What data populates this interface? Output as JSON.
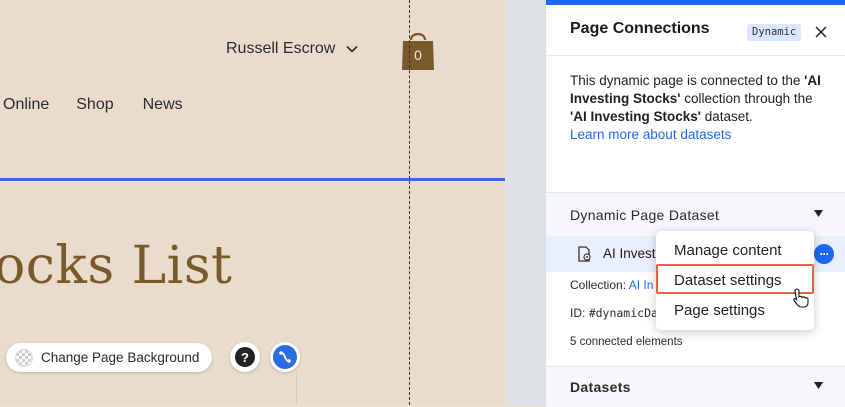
{
  "canvas": {
    "user_name": "Russell Escrow",
    "cart_count": "0",
    "nav": [
      "Online",
      "Shop",
      "News"
    ],
    "page_title": "ocks List",
    "change_bg_label": "Change Page Background",
    "help_symbol": "?"
  },
  "panel": {
    "title": "Page Connections",
    "badge": "Dynamic",
    "intro_1": "This dynamic page is connected to the",
    "collection_name": "'AI Investing Stocks'",
    "intro_2": "collection",
    "intro_3": "through the",
    "dataset_name": "'AI Investing Stocks'",
    "intro_4": "dataset.",
    "learn_more": "Learn more about datasets",
    "section_dataset": "Dynamic Page Dataset",
    "dataset_row_label": "AI Invest",
    "collection_label": "Collection:",
    "collection_value": "AI In",
    "id_label": "ID:",
    "id_value": "#dynamicDa",
    "connected": "5 connected elements",
    "section_datasets": "Datasets"
  },
  "menu": {
    "items": [
      "Manage content",
      "Dataset settings",
      "Page settings"
    ],
    "highlighted": "Dataset settings"
  },
  "colors": {
    "accent": "#1f68f0",
    "canvas_bg": "#e9dccd",
    "title_color": "#7a5a2a",
    "highlight_border": "#e0634f"
  },
  "icons": [
    "chevron-down-icon",
    "shopping-bag-icon",
    "close-icon",
    "help-icon",
    "connect-icon",
    "dataset-icon",
    "more-icon",
    "triangle-down-icon",
    "pointer-cursor-icon"
  ]
}
